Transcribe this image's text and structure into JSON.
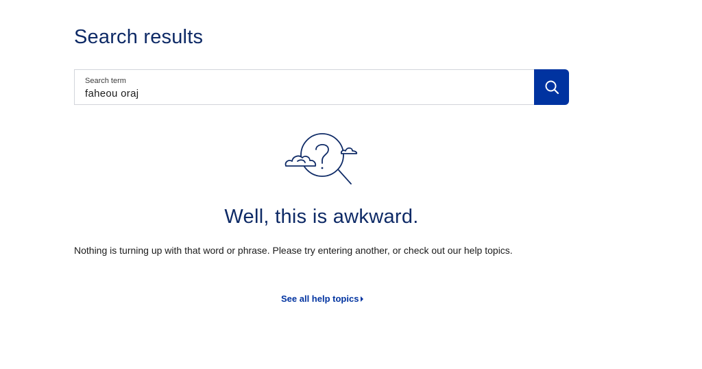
{
  "page": {
    "title": "Search results"
  },
  "search": {
    "label": "Search term",
    "value": "faheou oraj",
    "button_icon": "search-icon"
  },
  "empty_state": {
    "illustration_icon": "magnifier-question-clouds-icon",
    "heading": "Well, this is awkward.",
    "message": "Nothing is turning up with that word or phrase. Please try entering another, or check out our help topics.",
    "link_label": "See all help topics",
    "link_icon": "caret-right-icon"
  },
  "colors": {
    "brand_navy": "#0e2a66",
    "accent_blue": "#0033a0",
    "border": "#d2d4da"
  }
}
